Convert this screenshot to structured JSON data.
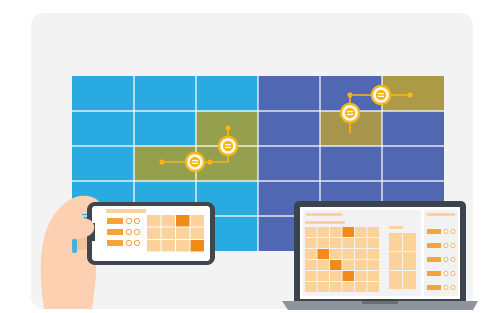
{
  "colors": {
    "panel_background": "#f3f3f3",
    "cyan_tile": "#29abe2",
    "blue_tile": "#5068b2",
    "olive_highlight": "#94a04d",
    "khaki_highlight": "#a8954d",
    "gold_highlight": "#ad9a47",
    "link_yellow": "#f8b617",
    "ui_orange": "#f6a43a",
    "ui_orange_light": "#fbd39a",
    "ui_orange_dark": "#f08c15",
    "skin": "#fcd0b0",
    "laptop_frame": "#3b434c",
    "phone_frame": "#3f464e"
  },
  "video_wall": {
    "rows": 5,
    "cols": 6,
    "tiles": [
      [
        "cyan",
        "cyan",
        "cyan",
        "blue",
        "blue",
        "gold"
      ],
      [
        "cyan",
        "cyan",
        "olive",
        "blue",
        "khaki",
        "blue"
      ],
      [
        "cyan",
        "olive",
        "olive",
        "blue",
        "blue",
        "blue"
      ],
      [
        "cyan",
        "cyan",
        "cyan",
        "blue",
        "blue",
        "blue"
      ],
      [
        "cyan",
        "cyan",
        "cyan",
        "blue",
        "blue",
        "blue"
      ]
    ]
  },
  "icons": {
    "equals_node": "equals-circle-icon",
    "link_dot": "connector-dot-icon",
    "hand": "hand-icon",
    "phone": "smartphone-icon",
    "laptop": "laptop-icon"
  }
}
